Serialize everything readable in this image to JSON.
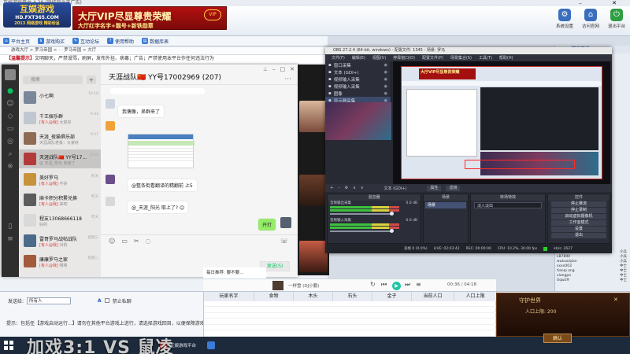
{
  "app": {
    "title": "互娱游戏平台 4.29 (完结完全无广告)",
    "logo_main": "互娱游戏",
    "logo_url": "HD.FXT365.COM",
    "logo_sub": "2013 网络游戏 精彩纷呈",
    "vip_title": "大厅VIP尽显尊贵荣耀",
    "vip_sub": "大厅红字名字+靓号+新铁勋章",
    "vip_small": "大厅红字名字·靓号·新勋章",
    "vip_emblem": "VIP",
    "header_buttons": [
      "系统设置",
      "访问官网",
      "退出平台"
    ],
    "nav": [
      "平台主页",
      "游戏购买",
      "互动论坛",
      "使用帮助",
      "数据库表"
    ],
    "breadcrumb": "游戏大厅 > 罗马帝国 > · · 罗马帝国 > 大厅",
    "notice_prefix": "【温馨提示】",
    "notice_text": "文明聊天，严禁谩骂，刷屏，发布外挂、病毒；广告；严禁使用本平台作任何违法行为",
    "right_panel_title": "游戏用户",
    "right_panel_rows": [
      {
        "name": "Ld09029",
        "tag": "小兵"
      },
      {
        "name": "LB7890",
        "tag": "小兵"
      },
      {
        "name": "wukuaiqian",
        "tag": "小兵"
      },
      {
        "name": "sxxx003",
        "tag": "中士"
      },
      {
        "name": "tianqi ang",
        "tag": "中士"
      },
      {
        "name": "xiangpo",
        "tag": "中士"
      },
      {
        "name": "Uqw29",
        "tag": "中士"
      }
    ],
    "say_label": "发送给:",
    "say_value": "所有人",
    "bold_label": "A",
    "checkbox_label": "禁止私聊",
    "tip_text": "提示：包括任【游戏启动运行...】请勿在其他平台游戏上进行，请选择游戏回目，以便保障游戏系统正常运行...",
    "caption": "加戏3:1 VS 鼠凌"
  },
  "chat": {
    "search_placeholder": "搜索",
    "title": "天涯战队🇨🇳 YY号17002969 (207)",
    "conversations": [
      {
        "name": "小七啊",
        "preview": "",
        "time": "10:18"
      },
      {
        "name": "千王娱乐群",
        "preview": "[有人@我] 大家好",
        "time": "9:43"
      },
      {
        "name": "天涯_夜猫俱乐部",
        "preview": "天涯战队老板：大家好",
        "time": "9:27"
      },
      {
        "name": "天涯战队🇨🇳 YY号17...",
        "preview": "@ 天涯_阳光 知道了",
        "time": "9:20"
      },
      {
        "name": "美好罗马",
        "preview": "[有人@我] 不好",
        "time": "昨天"
      },
      {
        "name": "麻卡积分积累兑换",
        "preview": "[有人@我] 来吧",
        "time": "昨天"
      },
      {
        "name": "程友13068666118",
        "preview": "好的",
        "time": "昨天"
      },
      {
        "name": "雷哥罗马战帖战队",
        "preview": "[有人@我] 对的",
        "time": "星期三"
      },
      {
        "name": "康康罗马之家",
        "preview": "[有人@我] 嗯嗯",
        "time": "星期二"
      }
    ],
    "messages": [
      {
        "name": "罗马战士",
        "text": "我偶像，呆群来了"
      },
      {
        "name": "天涯战队-阳光",
        "text": ""
      },
      {
        "name": "阳光",
        "text": "@整条街看翻译的精翻前 上5"
      },
      {
        "name": "天涯",
        "text": "@_天涯_阳光 取上了? 😊"
      }
    ],
    "sent_text": "开打",
    "send_button": "发送(S)",
    "toolbar_icons": [
      "emoji-icon",
      "folder-icon",
      "scissors-icon",
      "chat-bubble-icon"
    ]
  },
  "obs": {
    "title": "OBS 27.2.4 (64-bit, windows) - 配置文件: 1345 - 场景: 罗马",
    "menu": [
      "文件(F)",
      "编辑(E)",
      "视图(V)",
      "停靠窗口(D)",
      "配置文件(P)",
      "场景集合(S)",
      "工具(T)",
      "帮助(H)"
    ],
    "sources": [
      {
        "name": "窗口采集",
        "sel": false
      },
      {
        "name": "文本 (GDI+)",
        "sel": false
      },
      {
        "name": "视频输入采集",
        "sel": false
      },
      {
        "name": "视频输入采集",
        "sel": false
      },
      {
        "name": "图像",
        "sel": false
      },
      {
        "name": "显示器采集",
        "sel": true
      }
    ],
    "control_bar": [
      "文本 (GDI+)",
      "属性",
      "滤镜"
    ],
    "mixer_title": "混音器",
    "mixer_tracks": [
      {
        "name": "音频输出采集",
        "db": "0.0 dB"
      },
      {
        "name": "音频输入采集",
        "db": "0.0 dB"
      }
    ],
    "scenes_title": "场景",
    "scene_selected": "场景",
    "transition_title": "转场特效",
    "transition_value": "淡入淡出",
    "controls_title": "控件",
    "controls": [
      "停止推流",
      "停止录制",
      "启动虚拟摄像机",
      "工作室模式",
      "设置",
      "退出"
    ],
    "preview_banner": "大厅VIP尽显尊贵荣耀",
    "status": [
      "丢帧 0 (0.0%)",
      "LIVE: 02:03:42",
      "REC: 00:00:00",
      "CPU: 10.2%, 30.00 fps",
      "kb/s: 2627"
    ]
  },
  "sheet": {
    "columns": [
      "玩家名字",
      "食物",
      "木头",
      "石头",
      "金子",
      "当前人口",
      "人口上限"
    ]
  },
  "music": {
    "title": "一样雪 (DJ小鹏)",
    "time": "00:36 / 04:18",
    "daily_tip": "每日推荐: 要不要..."
  },
  "game_panel": {
    "title": "守护世界",
    "line": "人口上限: 200",
    "button": "确认",
    "close": "✕"
  },
  "taskbar": {
    "items": [
      {
        "label": "互娱游戏平台",
        "color": "#c92a2a"
      },
      {
        "label": "",
        "color": "#3a7bd5"
      }
    ]
  }
}
